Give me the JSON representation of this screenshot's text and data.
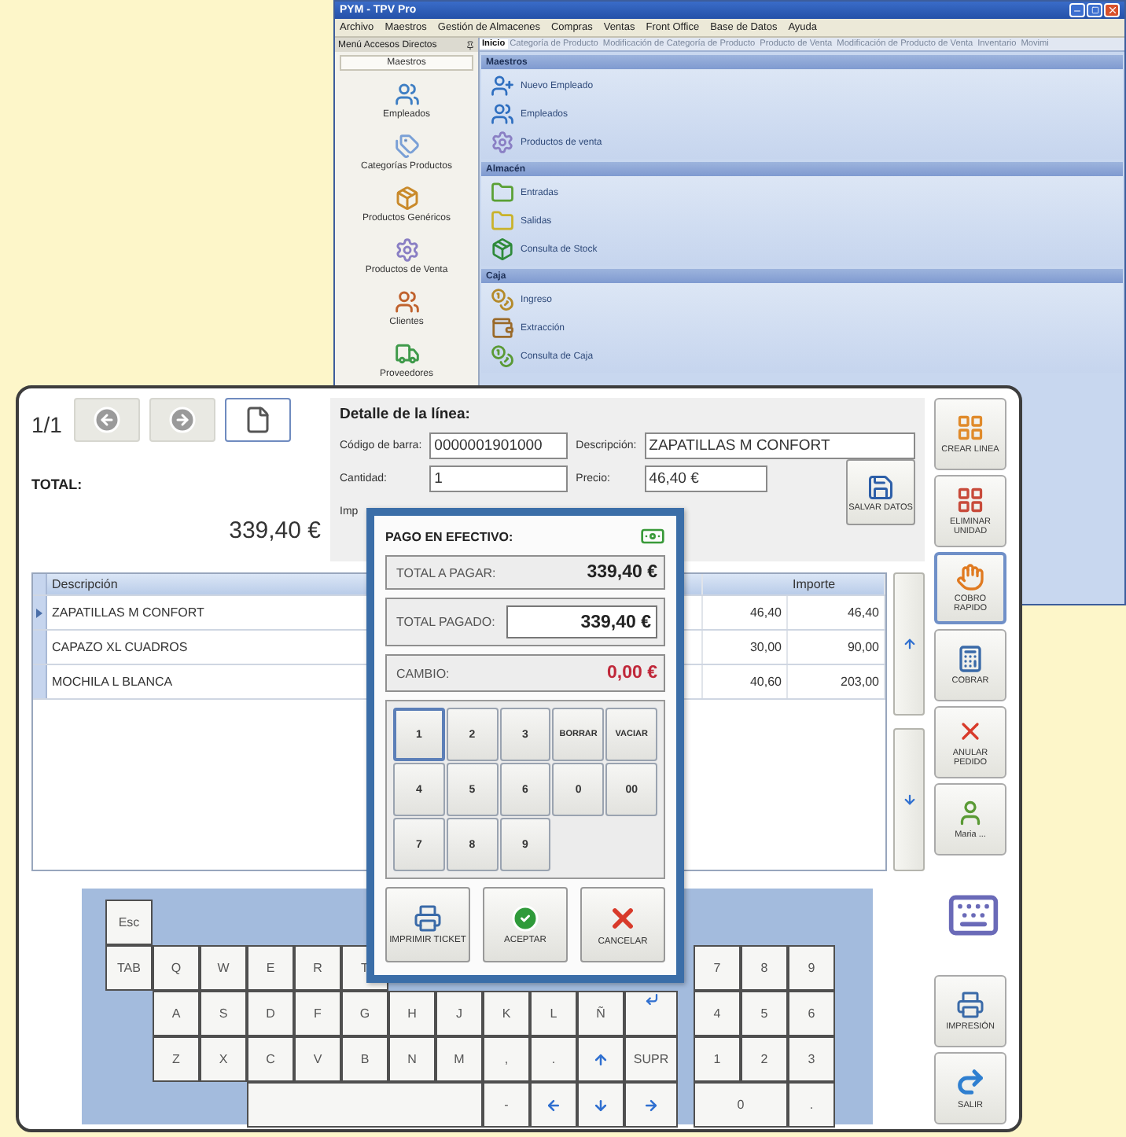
{
  "back_window": {
    "title": "PYM - TPV Pro",
    "menu": [
      "Archivo",
      "Maestros",
      "Gestión de Almacenes",
      "Compras",
      "Ventas",
      "Front Office",
      "Base de Datos",
      "Ayuda"
    ],
    "sidebar": {
      "title": "Menú Accesos Directos",
      "group": "Maestros",
      "items": [
        "Empleados",
        "Categorías Productos",
        "Productos Genéricos",
        "Productos de Venta",
        "Clientes",
        "Proveedores"
      ]
    },
    "tabs": [
      {
        "label": "Inicio",
        "selected": true
      },
      {
        "label": "Categoría de Producto",
        "selected": false
      },
      {
        "label": "Modificación de Categoría de Producto",
        "selected": false
      },
      {
        "label": "Producto de Venta",
        "selected": false
      },
      {
        "label": "Modificación de Producto de Venta",
        "selected": false
      },
      {
        "label": "Inventario",
        "selected": false
      },
      {
        "label": "Movimi",
        "selected": false
      }
    ],
    "sections": [
      {
        "title": "Maestros",
        "items": [
          "Nuevo Empleado",
          "Empleados",
          "Productos de venta"
        ]
      },
      {
        "title": "Almacén",
        "items": [
          "Entradas",
          "Salidas",
          "Consulta de Stock"
        ]
      },
      {
        "title": "Caja",
        "items": [
          "Ingreso",
          "Extracción",
          "Consulta de Caja"
        ]
      }
    ]
  },
  "sale_window": {
    "page": "1/1",
    "total_label": "TOTAL:",
    "total": "339,40 €",
    "detail": {
      "title": "Detalle de la línea:",
      "fields": [
        {
          "label": "Código de barra:",
          "value": "0000001901000"
        },
        {
          "label": "Descripción:",
          "value": "ZAPATILLAS M CONFORT"
        },
        {
          "label": "Cantidad:",
          "value": "1"
        },
        {
          "label": "Precio:",
          "value": "46,40 €"
        }
      ],
      "partial_label": "Imp",
      "save_button": "SALVAR DATOS"
    },
    "table": {
      "columns": {
        "description": "Descripción",
        "amount": "Importe"
      },
      "rows": [
        {
          "description": "ZAPATILLAS M CONFORT",
          "column_2": "46,40",
          "amount": "46,40",
          "selected": true
        },
        {
          "description": "CAPAZO XL CUADROS",
          "column_2": "30,00",
          "amount": "90,00",
          "selected": false
        },
        {
          "description": "MOCHILA L BLANCA",
          "column_2": "40,60",
          "amount": "203,00",
          "selected": false
        }
      ]
    },
    "toolbar": [
      {
        "label": "CREAR LINEA",
        "selected": false
      },
      {
        "label": "ELIMINAR UNIDAD",
        "selected": false
      },
      {
        "label": "COBRO RAPIDO",
        "selected": true
      },
      {
        "label": "COBRAR",
        "selected": false
      },
      {
        "label": "ANULAR PEDIDO",
        "selected": false
      },
      {
        "label": "Maria ...",
        "selected": false
      }
    ],
    "bottom_buttons": [
      "IMPRESIÓN",
      "SALIR"
    ],
    "keyboard": {
      "rows": [
        [
          {
            "kind": "key",
            "label": "Esc"
          }
        ],
        [
          {
            "kind": "key",
            "label": "TAB"
          },
          {
            "kind": "key",
            "label": "Q"
          },
          {
            "kind": "key",
            "label": "W"
          },
          {
            "kind": "key",
            "label": "E"
          },
          {
            "kind": "key",
            "label": "R"
          },
          {
            "kind": "key",
            "label": "T"
          }
        ],
        [
          {
            "kind": "gap"
          },
          {
            "kind": "key",
            "label": "A"
          },
          {
            "kind": "key",
            "label": "S"
          },
          {
            "kind": "key",
            "label": "D"
          },
          {
            "kind": "key",
            "label": "F"
          },
          {
            "kind": "key",
            "label": "G"
          },
          {
            "kind": "key",
            "label": "H"
          },
          {
            "kind": "key",
            "label": "J"
          },
          {
            "kind": "key",
            "label": "K"
          },
          {
            "kind": "key",
            "label": "L"
          },
          {
            "kind": "key",
            "label": "Ñ"
          },
          {
            "kind": "enter"
          }
        ],
        [
          {
            "kind": "gap"
          },
          {
            "kind": "key",
            "label": "Z"
          },
          {
            "kind": "key",
            "label": "X"
          },
          {
            "kind": "key",
            "label": "C"
          },
          {
            "kind": "key",
            "label": "V"
          },
          {
            "kind": "key",
            "label": "B"
          },
          {
            "kind": "key",
            "label": "N"
          },
          {
            "kind": "key",
            "label": "M"
          },
          {
            "kind": "key",
            "label": ","
          },
          {
            "kind": "key",
            "label": "."
          },
          {
            "kind": "up"
          },
          {
            "kind": "key",
            "label": "SUPR"
          }
        ],
        [
          {
            "kind": "gap"
          },
          {
            "kind": "gap"
          },
          {
            "kind": "gap"
          },
          {
            "kind": "space",
            "colspan": 5
          },
          {
            "kind": "key",
            "label": "-"
          },
          {
            "kind": "left"
          },
          {
            "kind": "down"
          },
          {
            "kind": "right"
          }
        ]
      ],
      "numpad": [
        {
          "kind": "key",
          "label": "7"
        },
        {
          "kind": "key",
          "label": "8"
        },
        {
          "kind": "key",
          "label": "9"
        },
        {
          "kind": "key",
          "label": "4"
        },
        {
          "kind": "key",
          "label": "5"
        },
        {
          "kind": "key",
          "label": "6"
        },
        {
          "kind": "key",
          "label": "1"
        },
        {
          "kind": "key",
          "label": "2"
        },
        {
          "kind": "key",
          "label": "3"
        },
        {
          "kind": "key",
          "label": "0",
          "colspan": 2
        },
        {
          "kind": "key",
          "label": "."
        }
      ]
    }
  },
  "dialog": {
    "title": "PAGO EN EFECTIVO:",
    "rows": [
      {
        "kind": "plain",
        "label": "TOTAL A PAGAR:",
        "value": "339,40 €"
      },
      {
        "kind": "input",
        "label": "TOTAL PAGADO:",
        "value": "339,40 €"
      },
      {
        "kind": "alert",
        "label": "CAMBIO:",
        "value": "0,00 €"
      }
    ],
    "keys": [
      {
        "label": "1",
        "focused": true
      },
      {
        "label": "2",
        "focused": false
      },
      {
        "label": "3",
        "focused": false
      },
      {
        "label": "BORRAR",
        "focused": false
      },
      {
        "label": "VACIAR",
        "focused": false
      },
      {
        "label": "4",
        "focused": false
      },
      {
        "label": "5",
        "focused": false
      },
      {
        "label": "6",
        "focused": false
      },
      {
        "label": "0",
        "focused": false
      },
      {
        "label": "00",
        "focused": false
      },
      {
        "label": "7",
        "focused": false
      },
      {
        "label": "8",
        "focused": false
      },
      {
        "label": "9",
        "focused": false
      }
    ],
    "buttons": [
      "IMPRIMIR TICKET",
      "ACEPTAR",
      "CANCELAR"
    ]
  }
}
